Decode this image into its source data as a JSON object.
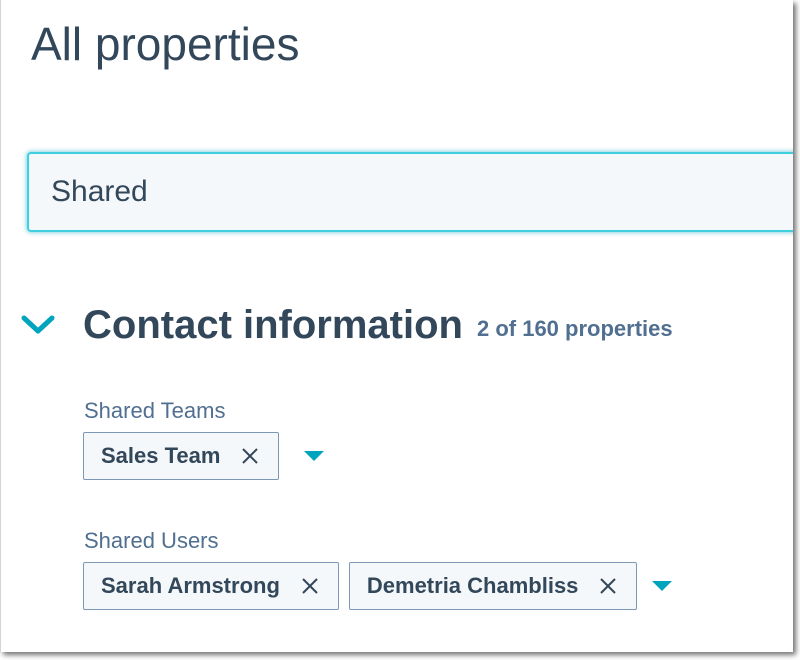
{
  "page": {
    "title": "All properties"
  },
  "search": {
    "value": "Shared"
  },
  "section": {
    "title": "Contact information",
    "count": "2 of 160 properties",
    "expanded": true
  },
  "fields": [
    {
      "label": "Shared Teams",
      "chips": [
        "Sales Team"
      ]
    },
    {
      "label": "Shared Users",
      "chips": [
        "Sarah Armstrong",
        "Demetria Chambliss"
      ]
    }
  ],
  "icons": {
    "expand": "chevron-down-icon",
    "remove": "close-icon",
    "dropdown": "caret-down-icon"
  },
  "colors": {
    "text": "#33475b",
    "secondary_text": "#516f90",
    "accent": "#00a4bd",
    "focus_border": "#3fd0e0",
    "chip_border": "#7c98b6",
    "chip_background": "#f5f8fa"
  }
}
